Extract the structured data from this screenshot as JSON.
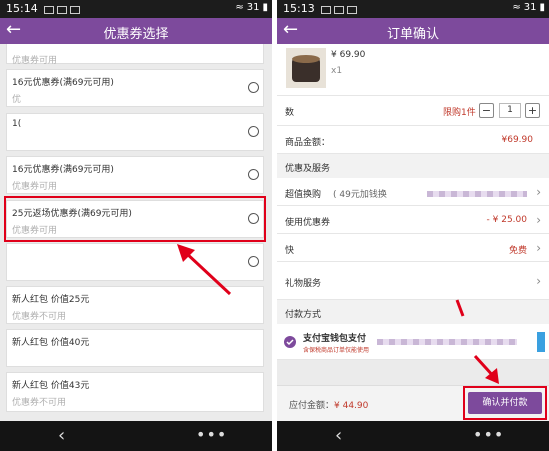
{
  "left_screen": {
    "status": {
      "time": "15:14",
      "signal": "31"
    },
    "title": "优惠券选择",
    "coupons": [
      {
        "name": "",
        "status": "优惠券可用"
      },
      {
        "name": "16元优惠券(满69元可用)",
        "status": "优"
      },
      {
        "name": "1(",
        "status": ""
      },
      {
        "name": "16元优惠券(满69元可用)",
        "status": "优惠券可用"
      },
      {
        "name": "25元返场优惠券(满69元可用)",
        "status": "优惠券可用"
      },
      {
        "name": "",
        "status": ""
      },
      {
        "name": "新人红包 价值25元",
        "status": "优惠券不可用"
      },
      {
        "name": "新人红包 价值40元",
        "status": ""
      },
      {
        "name": "新人红包 价值43元",
        "status": "优惠券不可用"
      }
    ]
  },
  "right_screen": {
    "status": {
      "time": "15:13",
      "signal": "31"
    },
    "title": "订单确认",
    "product": {
      "price": "¥ 69.90",
      "qty": "x1"
    },
    "limit_label": "限购1件",
    "stepper": {
      "minus": "−",
      "value": "1",
      "plus": "+"
    },
    "quantity_label": "数",
    "goods_amount_label": "商品金额：",
    "goods_amount_value": "¥69.90",
    "section_discount": "优惠及服务",
    "value_buy_label": "超值换购",
    "value_buy_detail": "( 49元加钱换",
    "coupon_label": "使用优惠券",
    "coupon_value": "- ¥ 25.00",
    "shipping_label": "快",
    "shipping_value": "免费",
    "gift_label": "礼物服务",
    "section_payment": "付款方式",
    "payment_method": "支付宝钱包支付",
    "payment_note": "含保税商品订单仅能使用",
    "total_label": "应付金额：",
    "total_value": "¥ 44.90",
    "confirm_label": "确认并付款"
  },
  "colors": {
    "brand": "#7d4a9c",
    "highlight": "#e0001a",
    "price": "#c0392b"
  }
}
